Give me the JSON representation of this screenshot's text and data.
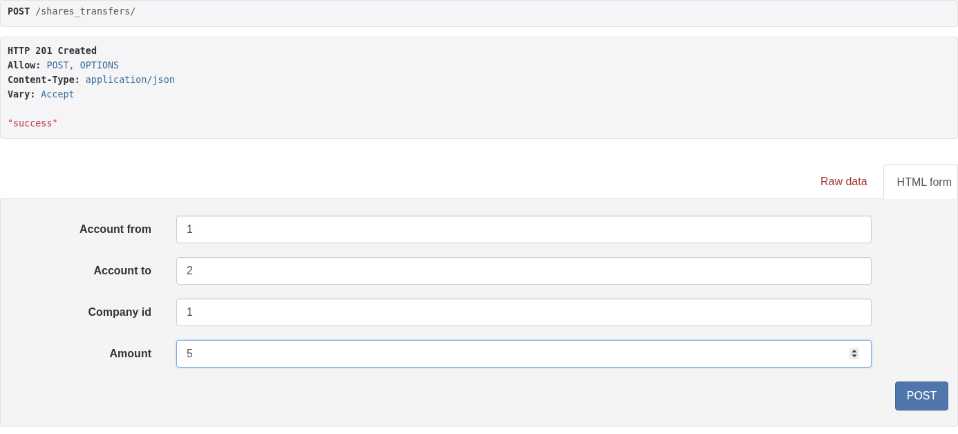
{
  "request": {
    "method": "POST",
    "path": "/shares_transfers/"
  },
  "response": {
    "status": "HTTP 201 Created",
    "headers": [
      {
        "name": "Allow:",
        "value": "POST, OPTIONS"
      },
      {
        "name": "Content-Type:",
        "value": "application/json"
      },
      {
        "name": "Vary:",
        "value": "Accept"
      }
    ],
    "body": "\"success\""
  },
  "tabs": [
    {
      "label": "Raw data",
      "selected": false
    },
    {
      "label": "HTML form",
      "selected": true
    }
  ],
  "form": {
    "fields": [
      {
        "label": "Account from",
        "value": "1",
        "kind": "text",
        "focused": false
      },
      {
        "label": "Account to",
        "value": "2",
        "kind": "text",
        "focused": false
      },
      {
        "label": "Company id",
        "value": "1",
        "kind": "text",
        "focused": false
      },
      {
        "label": "Amount",
        "value": "5",
        "kind": "number",
        "focused": true
      }
    ],
    "submit": "POST"
  }
}
